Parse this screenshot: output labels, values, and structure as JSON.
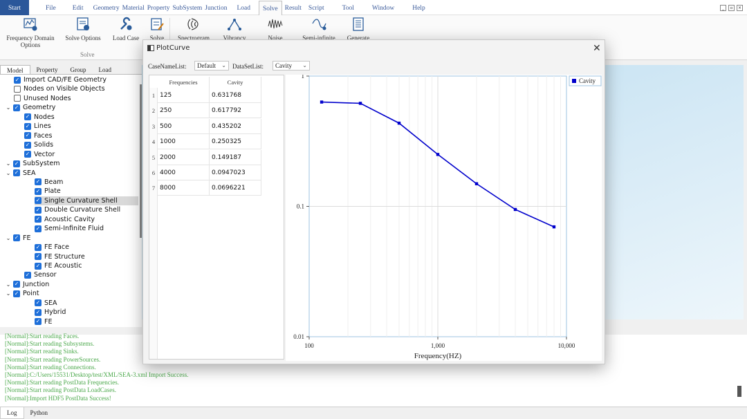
{
  "menubar": {
    "items": [
      "Start",
      "File",
      "Edit",
      "Geometry",
      "Material",
      "Property",
      "SubSystem",
      "Junction",
      "Load",
      "Solve",
      "Result",
      "Script",
      "Tool",
      "Window",
      "Help"
    ]
  },
  "ribbon": {
    "buttons": [
      "Frequency Domain\nOptions",
      "Solve Options",
      "Load Case",
      "Solve",
      "Spectrogram",
      "Vibrancy",
      "Noise",
      "Semi-infinite",
      "Generate"
    ],
    "group_label": "Solve"
  },
  "left_tabs": [
    "Model",
    "Property",
    "Group",
    "Load"
  ],
  "tree": [
    {
      "label": "Import CAD/FE Geometry",
      "level": 1,
      "checked": true
    },
    {
      "label": "Nodes on Visible Objects",
      "level": 1,
      "checked": false
    },
    {
      "label": "Unused Nodes",
      "level": 1,
      "checked": false
    },
    {
      "label": "Geometry",
      "level": 0,
      "checked": true,
      "expand": true
    },
    {
      "label": "Nodes",
      "level": 2,
      "checked": true
    },
    {
      "label": "Lines",
      "level": 2,
      "checked": true
    },
    {
      "label": "Faces",
      "level": 2,
      "checked": true
    },
    {
      "label": "Solids",
      "level": 2,
      "checked": true
    },
    {
      "label": "Vector",
      "level": 2,
      "checked": true
    },
    {
      "label": "SubSystem",
      "level": 0,
      "checked": true,
      "expand": true
    },
    {
      "label": "SEA",
      "level": 1,
      "checked": true,
      "expand": true
    },
    {
      "label": "Beam",
      "level": 3,
      "checked": true
    },
    {
      "label": "Plate",
      "level": 3,
      "checked": true
    },
    {
      "label": "Single Curvature Shell",
      "level": 3,
      "checked": true,
      "selected": true
    },
    {
      "label": "Double Curvature Shell",
      "level": 3,
      "checked": true
    },
    {
      "label": "Acoustic Cavity",
      "level": 3,
      "checked": true
    },
    {
      "label": "Semi-Infinite Fluid",
      "level": 3,
      "checked": true
    },
    {
      "label": "FE",
      "level": 1,
      "checked": true,
      "expand": true
    },
    {
      "label": "FE Face",
      "level": 3,
      "checked": true
    },
    {
      "label": "FE Structure",
      "level": 3,
      "checked": true
    },
    {
      "label": "FE Acoustic",
      "level": 3,
      "checked": true
    },
    {
      "label": "Sensor",
      "level": 2,
      "checked": true
    },
    {
      "label": "Junction",
      "level": 0,
      "checked": true,
      "expand": true
    },
    {
      "label": "Point",
      "level": 1,
      "checked": true,
      "expand": true
    },
    {
      "label": "SEA",
      "level": 3,
      "checked": true
    },
    {
      "label": "Hybrid",
      "level": 3,
      "checked": true
    },
    {
      "label": "FE",
      "level": 3,
      "checked": true
    }
  ],
  "log": [
    "[Normal]:Start reading Faces.",
    "[Normal]:Start reading Subsystems.",
    "[Normal]:Start reading Sinks.",
    "[Normal]:Start reading PowerSources.",
    "[Normal]:Start reading Connections.",
    "[Normal]:C:/Users/15531/Desktop/test/XML/SEA-3.xml Import Success.",
    "[Normal]:Start reading PostData Frequencies.",
    "[Normal]:Start reading PostData LoadCases.",
    "[Normal]:Import HDF5 PostData Success!"
  ],
  "bottom_tabs": [
    "Log",
    "Python"
  ],
  "dialog": {
    "title": "PlotCurve",
    "close": "✕",
    "case_label": "CaseNameList:",
    "case_value": "Default",
    "dataset_label": "DataSetList:",
    "dataset_value": "Cavity",
    "table": {
      "headers": [
        "Frequencies",
        "Cavity"
      ],
      "rows": [
        [
          "125",
          "0.631768"
        ],
        [
          "250",
          "0.617792"
        ],
        [
          "500",
          "0.435202"
        ],
        [
          "1000",
          "0.250325"
        ],
        [
          "2000",
          "0.149187"
        ],
        [
          "4000",
          "0.0947023"
        ],
        [
          "8000",
          "0.0696221"
        ]
      ]
    }
  },
  "chart_data": {
    "type": "line",
    "x": [
      125,
      250,
      500,
      1000,
      2000,
      4000,
      8000
    ],
    "series": [
      {
        "name": "Cavity",
        "values": [
          0.631768,
          0.617792,
          0.435202,
          0.250325,
          0.149187,
          0.0947023,
          0.0696221
        ],
        "color": "#0000cc"
      }
    ],
    "xlabel": "Frequency(HZ)",
    "ylabel": "",
    "xscale": "log",
    "yscale": "log",
    "xlim": [
      100,
      10000
    ],
    "ylim": [
      0.01,
      1
    ],
    "xticks": [
      "100",
      "1,000",
      "10,000"
    ],
    "yticks": [
      "1",
      "0.1",
      "0.01"
    ],
    "grid": true,
    "legend": "top-right"
  },
  "colors": {
    "start_tab": "#2b579a",
    "series": "#0000cc",
    "log_text": "#4aa84a",
    "checkbox": "#1e6fd9"
  }
}
